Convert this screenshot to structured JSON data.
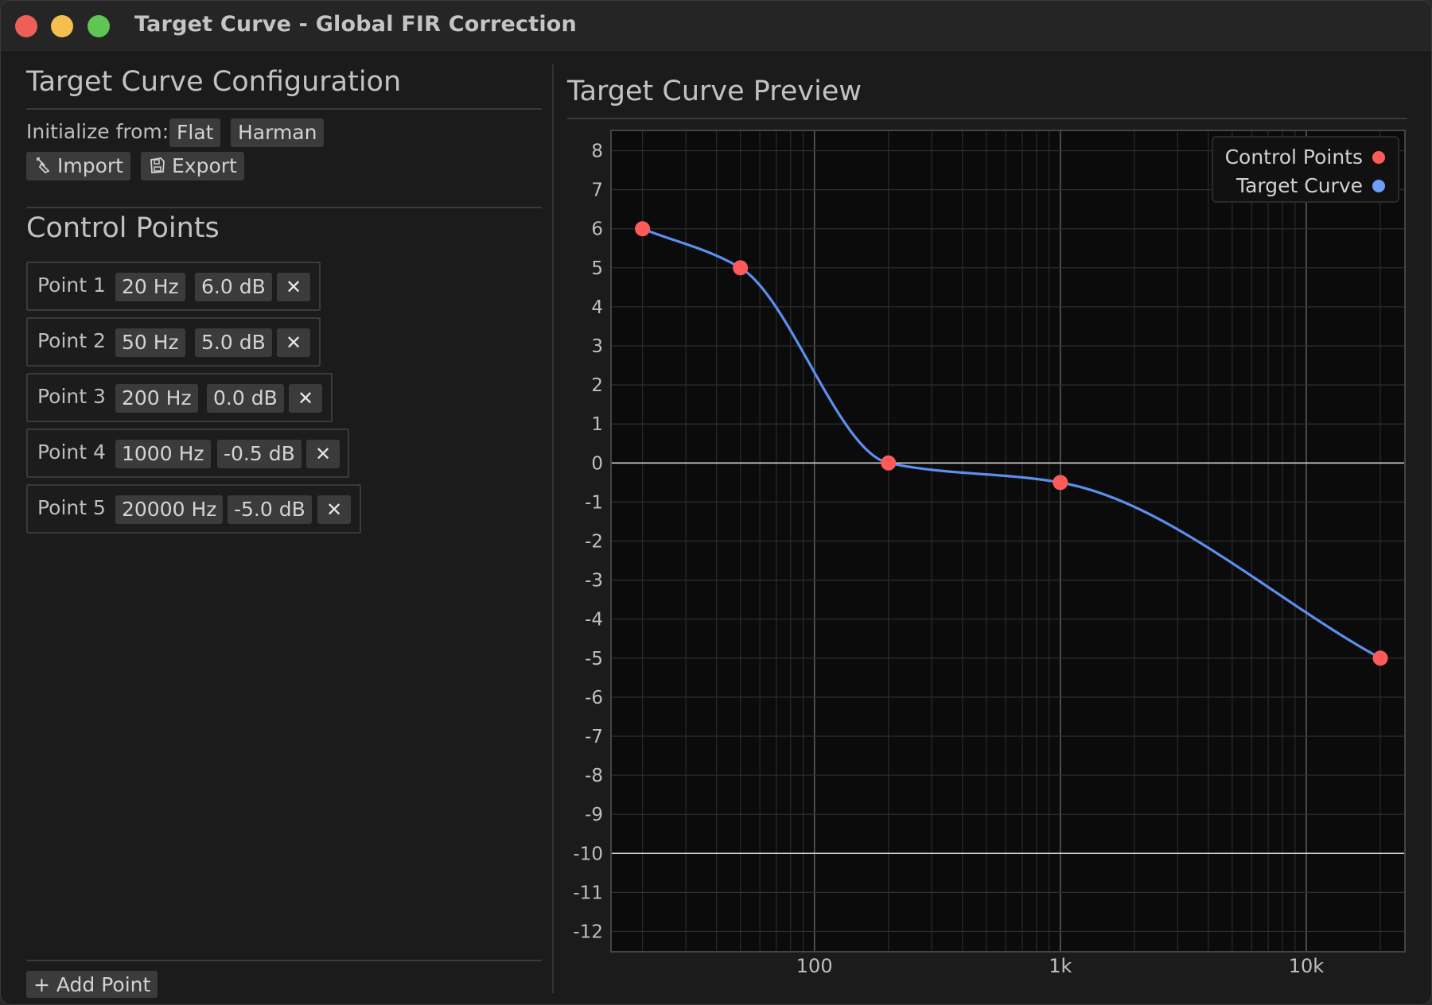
{
  "window": {
    "title": "Target Curve - Global FIR Correction"
  },
  "config": {
    "title": "Target Curve Configuration",
    "initialize_label": "Initialize from:",
    "flat_label": "Flat",
    "harman_label": "Harman",
    "import_label": "Import",
    "export_label": "Export"
  },
  "control_points": {
    "title": "Control Points",
    "remove_glyph": "✕",
    "add_label": "+ Add Point",
    "items": [
      {
        "name": "Point 1",
        "freq": "20 Hz",
        "gain": "6.0 dB"
      },
      {
        "name": "Point 2",
        "freq": "50 Hz",
        "gain": "5.0 dB"
      },
      {
        "name": "Point 3",
        "freq": "200 Hz",
        "gain": "0.0 dB"
      },
      {
        "name": "Point 4",
        "freq": "1000 Hz",
        "gain": "-0.5 dB"
      },
      {
        "name": "Point 5",
        "freq": "20000 Hz",
        "gain": "-5.0 dB"
      }
    ]
  },
  "preview": {
    "title": "Target Curve Preview",
    "legend": {
      "control_points": "Control Points",
      "target_curve": "Target Curve"
    }
  },
  "colors": {
    "control_point": "#ff5a5a",
    "curve": "#5b8ff0",
    "legend_curve_dot": "#6f9ff5"
  },
  "chart_data": {
    "type": "line",
    "x_scale": "log",
    "xlim": [
      15,
      25000
    ],
    "ylim": [
      -12.5,
      8.5
    ],
    "grid": true,
    "legend_position": "top-right",
    "x_ticks": [
      {
        "value": 100,
        "label": "100"
      },
      {
        "value": 1000,
        "label": "1k"
      },
      {
        "value": 10000,
        "label": "10k"
      }
    ],
    "y_ticks": [
      8,
      7,
      6,
      5,
      4,
      3,
      2,
      1,
      0,
      -1,
      -2,
      -3,
      -4,
      -5,
      -6,
      -7,
      -8,
      -9,
      -10,
      -11,
      -12
    ],
    "series": [
      {
        "name": "Control Points",
        "kind": "points",
        "x": [
          20,
          50,
          200,
          1000,
          20000
        ],
        "y": [
          6.0,
          5.0,
          0.0,
          -0.5,
          -5.0
        ]
      },
      {
        "name": "Target Curve",
        "kind": "line",
        "x": [
          20,
          50,
          200,
          1000,
          20000
        ],
        "y": [
          6.0,
          5.0,
          0.0,
          -0.5,
          -5.0
        ]
      }
    ]
  }
}
